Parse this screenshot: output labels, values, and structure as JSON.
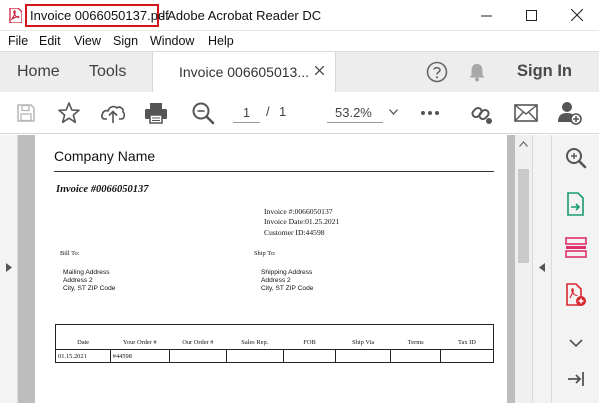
{
  "window": {
    "file_title": "Invoice 0066050137.pdf",
    "app_title": "- Adobe Acrobat Reader DC"
  },
  "menu": [
    "File",
    "Edit",
    "View",
    "Sign",
    "Window",
    "Help"
  ],
  "tabs": {
    "home": "Home",
    "tools": "Tools",
    "document": "Invoice 006605013...",
    "sign_in": "Sign In"
  },
  "toolbar": {
    "page_current": "1",
    "page_separator": "/",
    "page_total": "1",
    "zoom": "53.2%"
  },
  "document": {
    "company": "Company Name",
    "invoice_heading": "Invoice #0066050137",
    "invoice_no": "Invoice #:0066050137",
    "invoice_date": "Invoice Date:01.25.2021",
    "customer_id": "Customer ID:44598",
    "bill_to_label": "Bill To:",
    "ship_to_label": "Ship To:",
    "bill_to": [
      "Mailing Address",
      "Address 2",
      "City, ST  ZIP Code"
    ],
    "ship_to": [
      "Shipping Address",
      "Address 2",
      "City, ST  ZIP Code"
    ],
    "table": {
      "headers": [
        "Date",
        "Your Order #",
        "Our Order #",
        "Sales Rep.",
        "FOB",
        "Ship Via",
        "Terms",
        "Tax ID"
      ],
      "rows": [
        [
          "01.15.2021",
          "#44598",
          "",
          "",
          "",
          "",
          "",
          ""
        ]
      ]
    }
  },
  "colors": {
    "title_highlight": "#d4131b",
    "accent_green": "#1a9c6c",
    "accent_pink": "#e0306a",
    "accent_red": "#d8282f"
  },
  "icons": [
    "pdf-icon",
    "minimize-icon",
    "maximize-icon",
    "close-icon",
    "help-icon",
    "bell-icon",
    "save-icon",
    "star-icon",
    "upload-icon",
    "print-icon",
    "zoom-search-icon",
    "more-icon",
    "link-icon",
    "mail-icon",
    "add-user-icon"
  ]
}
